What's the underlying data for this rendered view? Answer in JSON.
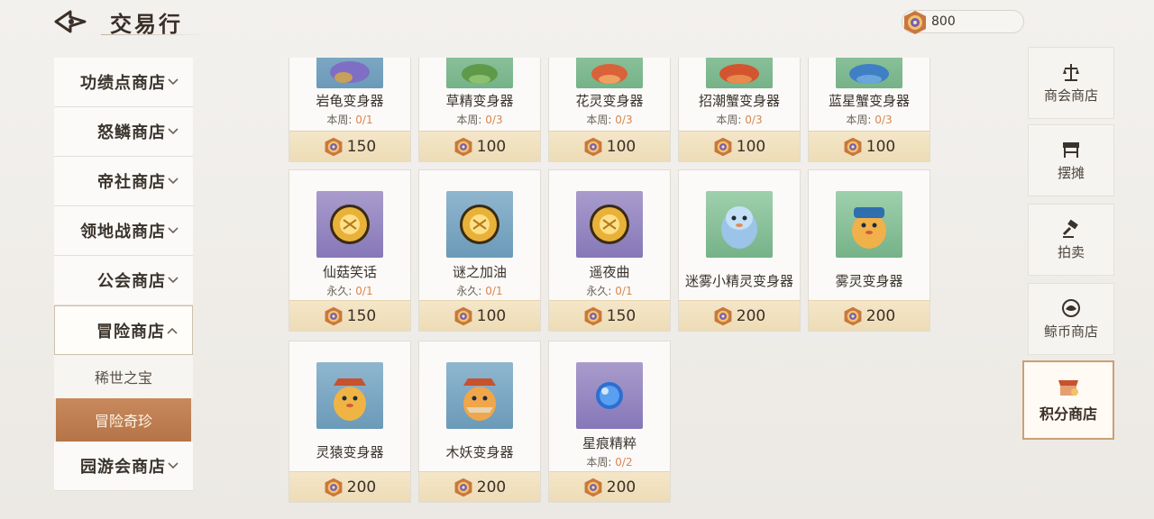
{
  "header": {
    "title": "交易行",
    "currency_amount": "800"
  },
  "left_menu": {
    "items": [
      {
        "label": "功绩点商店"
      },
      {
        "label": "怒鳞商店"
      },
      {
        "label": "帝社商店"
      },
      {
        "label": "领地战商店"
      },
      {
        "label": "公会商店"
      },
      {
        "label": "冒险商店"
      }
    ],
    "submenu": [
      {
        "label": "稀世之宝"
      },
      {
        "label": "冒险奇珍"
      }
    ],
    "last_item": {
      "label": "园游会商店"
    }
  },
  "items": [
    {
      "name": "岩龟变身器",
      "limit_label": "本周:",
      "limit_count": "0/1",
      "price": "150"
    },
    {
      "name": "草精变身器",
      "limit_label": "本周:",
      "limit_count": "0/3",
      "price": "100"
    },
    {
      "name": "花灵变身器",
      "limit_label": "本周:",
      "limit_count": "0/3",
      "price": "100"
    },
    {
      "name": "招潮蟹变身器",
      "limit_label": "本周:",
      "limit_count": "0/3",
      "price": "100"
    },
    {
      "name": "蓝星蟹变身器",
      "limit_label": "本周:",
      "limit_count": "0/3",
      "price": "100"
    },
    {
      "name": "仙菇笑话",
      "limit_label": "永久:",
      "limit_count": "0/1",
      "price": "150"
    },
    {
      "name": "谜之加油",
      "limit_label": "永久:",
      "limit_count": "0/1",
      "price": "100"
    },
    {
      "name": "遥夜曲",
      "limit_label": "永久:",
      "limit_count": "0/1",
      "price": "150"
    },
    {
      "name": "迷雾小精灵变身器",
      "limit_label": "",
      "limit_count": "",
      "price": "200"
    },
    {
      "name": "雾灵变身器",
      "limit_label": "",
      "limit_count": "",
      "price": "200"
    },
    {
      "name": "灵猿变身器",
      "limit_label": "",
      "limit_count": "",
      "price": "200"
    },
    {
      "name": "木妖变身器",
      "limit_label": "",
      "limit_count": "",
      "price": "200"
    },
    {
      "name": "星痕精粹",
      "limit_label": "本周:",
      "limit_count": "0/2",
      "price": "200"
    }
  ],
  "right_tabs": [
    {
      "label": "商会商店",
      "icon": "scale-icon"
    },
    {
      "label": "摆摊",
      "icon": "stall-icon"
    },
    {
      "label": "拍卖",
      "icon": "gavel-icon"
    },
    {
      "label": "鲸币商店",
      "icon": "whale-coin-icon"
    },
    {
      "label": "积分商店",
      "icon": "points-shop-icon"
    }
  ]
}
